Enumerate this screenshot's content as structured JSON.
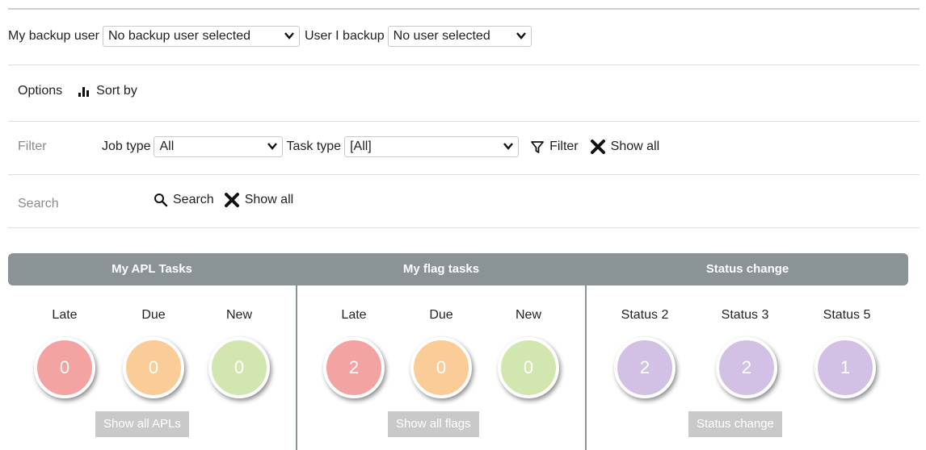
{
  "backup": {
    "my_backup_label": "My backup user",
    "my_backup_value": "No backup user selected",
    "user_i_backup_label": "User I backup",
    "user_i_backup_value": "No user selected"
  },
  "options": {
    "options_label": "Options",
    "sort_label": "Sort by"
  },
  "filter": {
    "section_label": "Filter",
    "job_type_label": "Job type",
    "job_type_value": "All",
    "task_type_label": "Task type",
    "task_type_value": "[All]",
    "filter_label": "Filter",
    "show_all_label": "Show all"
  },
  "search": {
    "section_label": "Search",
    "search_label": "Search",
    "show_all_label": "Show all"
  },
  "dashboard": {
    "apl": {
      "title": "My APL Tasks",
      "stats": [
        {
          "label": "Late",
          "value": "0",
          "color": "#f4a3a3"
        },
        {
          "label": "Due",
          "value": "0",
          "color": "#f9cc98"
        },
        {
          "label": "New",
          "value": "0",
          "color": "#d2e7b0"
        }
      ],
      "button": "Show all APLs"
    },
    "flag": {
      "title": "My flag tasks",
      "stats": [
        {
          "label": "Late",
          "value": "2",
          "color": "#f4a3a3"
        },
        {
          "label": "Due",
          "value": "0",
          "color": "#f9cc98"
        },
        {
          "label": "New",
          "value": "0",
          "color": "#d2e7b0"
        }
      ],
      "button": "Show all flags"
    },
    "status": {
      "title": "Status change",
      "stats": [
        {
          "label": "Status 2",
          "value": "2",
          "color": "#d2c1e4"
        },
        {
          "label": "Status 3",
          "value": "2",
          "color": "#d2c1e4"
        },
        {
          "label": "Status 5",
          "value": "1",
          "color": "#d2c1e4"
        }
      ],
      "button": "Status change"
    }
  },
  "icons": {
    "sort": "bar-chart-icon",
    "filter": "funnel-icon",
    "clear": "close-x-icon",
    "search": "magnifier-icon",
    "dropdown": "chevron-down-icon"
  }
}
